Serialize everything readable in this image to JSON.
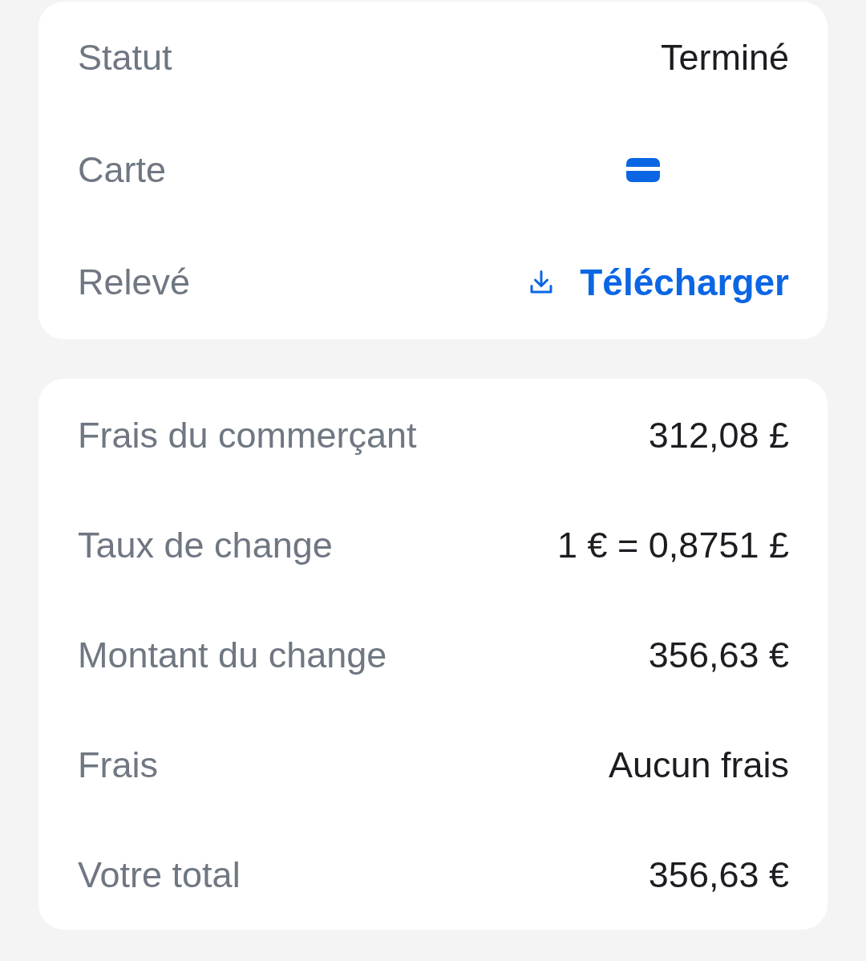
{
  "sections": [
    {
      "rows": [
        {
          "label": "Statut",
          "kind": "text",
          "value": "Terminé"
        },
        {
          "label": "Carte",
          "kind": "card"
        },
        {
          "label": "Relevé",
          "kind": "download",
          "value": "Télécharger"
        }
      ]
    },
    {
      "rows": [
        {
          "label": "Frais du commerçant",
          "kind": "text",
          "value": "312,08 £"
        },
        {
          "label": "Taux de change",
          "kind": "text",
          "value": "1 € = 0,8751 £"
        },
        {
          "label": "Montant du change",
          "kind": "text",
          "value": "356,63 €"
        },
        {
          "label": "Frais",
          "kind": "text",
          "value": "Aucun frais"
        },
        {
          "label": "Votre total",
          "kind": "text",
          "value": "356,63 €"
        }
      ]
    }
  ]
}
